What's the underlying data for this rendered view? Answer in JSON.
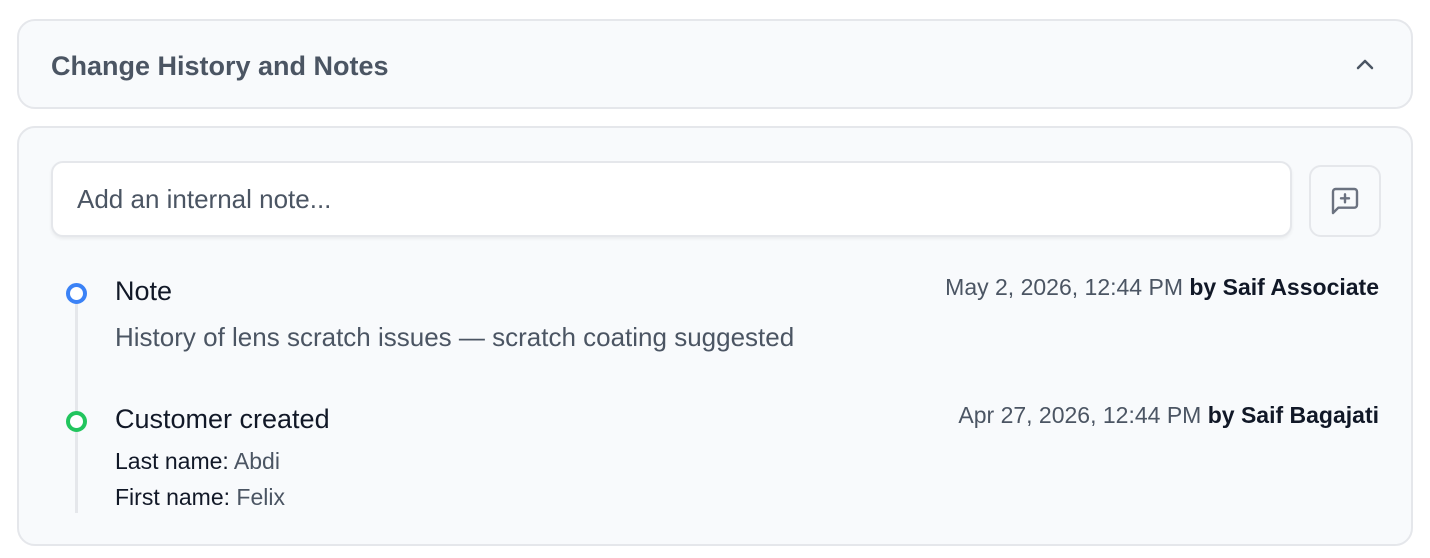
{
  "header": {
    "title": "Change History and Notes",
    "collapse_icon": "chevron-up-icon"
  },
  "note_composer": {
    "placeholder": "Add an internal note...",
    "value": "",
    "add_button_icon": "message-square-plus-icon"
  },
  "timeline": [
    {
      "type": "Note",
      "dot_color": "#3b82f6",
      "timestamp": "May 2, 2026, 12:44 PM",
      "by_text": "by Saif Associate",
      "body": "History of lens scratch issues — scratch coating suggested"
    },
    {
      "type": "Customer created",
      "dot_color": "#22c55e",
      "timestamp": "Apr 27, 2026, 12:44 PM",
      "by_text": "by Saif Bagajati",
      "fields": [
        {
          "label": "Last name:",
          "value": "Abdi"
        },
        {
          "label": "First name:",
          "value": "Felix"
        }
      ]
    }
  ]
}
